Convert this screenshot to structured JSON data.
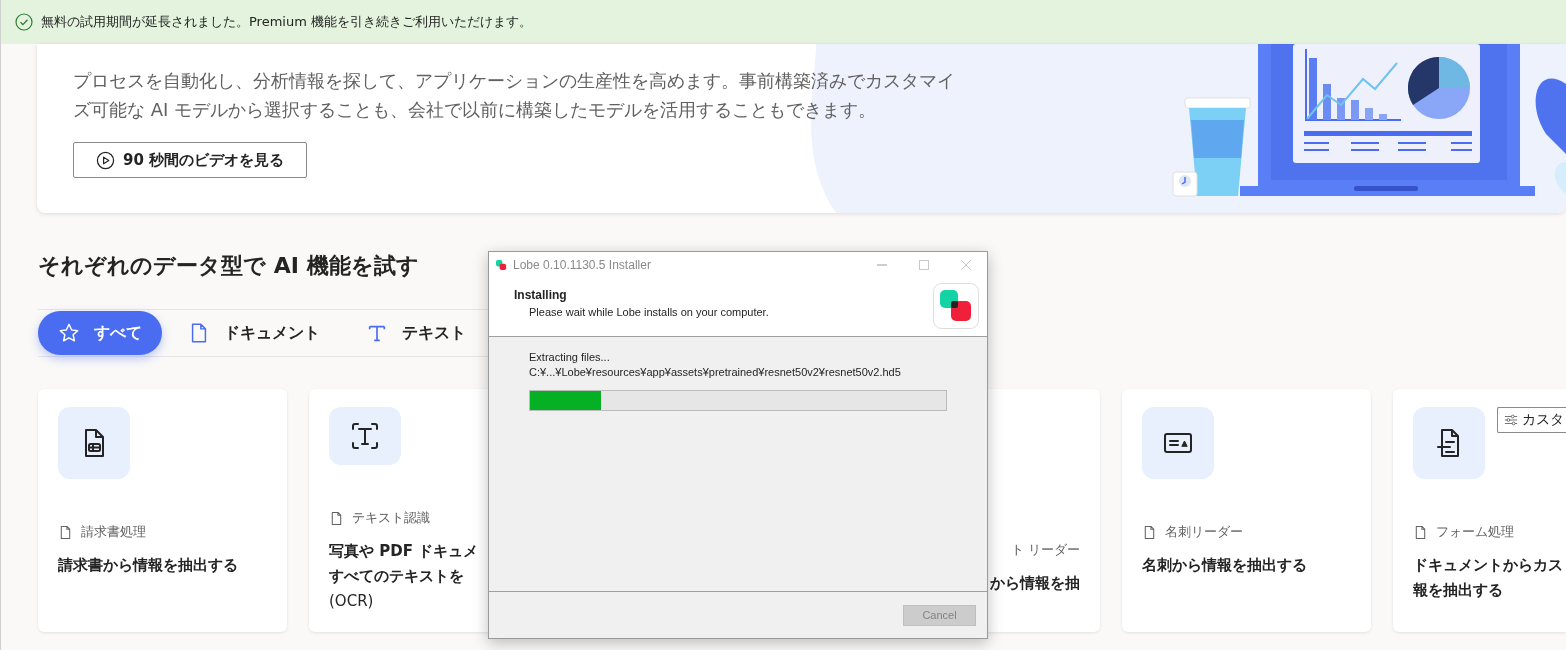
{
  "notice": {
    "text": "無料の試用期間が延長されました。Premium 機能を引き続きご利用いただけます。"
  },
  "hero": {
    "description": "プロセスを自動化し、分析情報を探して、アプリケーションの生産性を高めます。事前構築済みでカスタマイズ可能な AI モデルから選択することも、会社で以前に構築したモデルを活用することもできます。",
    "video_button": "90 秒間のビデオを見る"
  },
  "section": {
    "heading": "それぞれのデータ型で AI 機能を試す"
  },
  "tabs": [
    {
      "label": "すべて",
      "selected": true
    },
    {
      "label": "ドキュメント",
      "selected": false
    },
    {
      "label": "テキスト",
      "selected": false
    }
  ],
  "cards": [
    {
      "kind": "full",
      "category": "請求書処理",
      "title_lines": [
        "請求書から情報を抽出する"
      ]
    },
    {
      "kind": "full",
      "category": "テキスト認識",
      "title_lines": [
        "写真や PDF ドキュメ",
        "すべてのテキストを",
        "(OCR)"
      ]
    },
    {
      "kind": "partial",
      "category": "ト リーダー",
      "title_lines": [
        "から情報を抽"
      ]
    },
    {
      "kind": "full",
      "category": "名刺リーダー",
      "title_lines": [
        "名刺から情報を抽出する"
      ]
    },
    {
      "kind": "full",
      "category": "フォーム処理",
      "title_lines": [
        "ドキュメントからカス",
        "報を抽出する"
      ],
      "button": "カスタ"
    }
  ],
  "installer": {
    "title": "Lobe 0.10.1130.5 Installer",
    "heading": "Installing",
    "subtitle": "Please wait while Lobe installs on your computer.",
    "status": "Extracting files...",
    "file_path": "C:¥...¥Lobe¥resources¥app¥assets¥pretrained¥resnet50v2¥resnet50v2.hd5",
    "progress": {
      "level": 0.17
    },
    "cancel_button": {
      "label": "Cancel",
      "disabled": true
    }
  }
}
